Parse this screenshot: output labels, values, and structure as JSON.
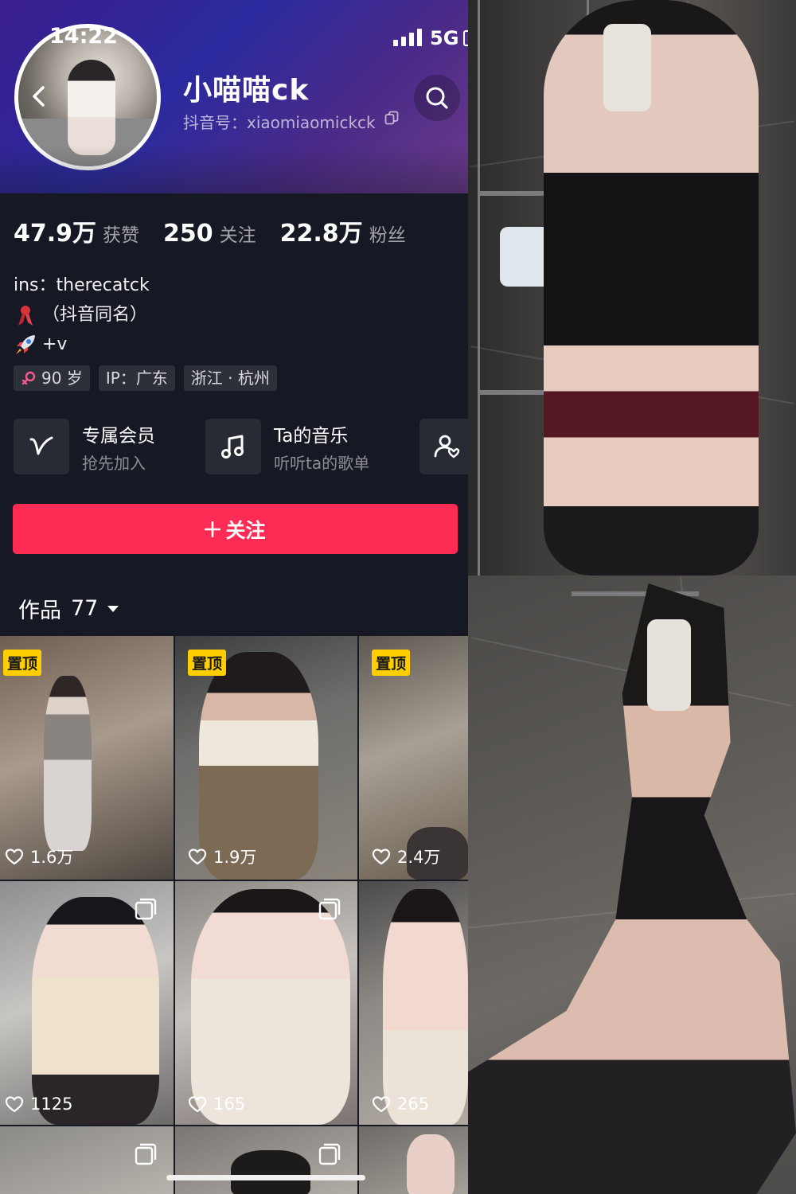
{
  "status_bar": {
    "time": "14:22",
    "network": "5G"
  },
  "profile": {
    "nickname": "小喵喵ck",
    "douyin_id": "抖音号：xiaomiaomickck",
    "stats": [
      {
        "value": "47.9万",
        "label": "获赞"
      },
      {
        "value": "250",
        "label": "关注"
      },
      {
        "value": "22.8万",
        "label": "粉丝"
      }
    ],
    "bio": [
      {
        "text": "ins：therecatck",
        "icon": ""
      },
      {
        "text": "（抖音同名）",
        "icon": "ribbon-emoji-icon"
      },
      {
        "text": "+v",
        "icon": "rocket-emoji-icon"
      }
    ],
    "tags": [
      {
        "text": "90 岁",
        "icon": "female-icon"
      },
      {
        "text": "IP：广东",
        "icon": ""
      },
      {
        "text": "浙江 · 杭州",
        "icon": ""
      }
    ]
  },
  "features": [
    {
      "title": "专属会员",
      "subtitle": "抢先加入",
      "icon": "membership-v-icon"
    },
    {
      "title": "Ta的音乐",
      "subtitle": "听听ta的歌单",
      "icon": "music-note-icon"
    },
    {
      "title": "",
      "subtitle": "",
      "icon": "user-heart-icon"
    }
  ],
  "follow_button": "关注",
  "works": {
    "label": "作品",
    "count": "77"
  },
  "videos": [
    {
      "pinned": "置顶",
      "likes": "1.6万",
      "multi": false
    },
    {
      "pinned": "置顶",
      "likes": "1.9万",
      "multi": false
    },
    {
      "pinned": "置顶",
      "likes": "2.4万",
      "multi": false
    },
    {
      "pinned": "",
      "likes": "1125",
      "multi": true
    },
    {
      "pinned": "",
      "likes": "165",
      "multi": true
    },
    {
      "pinned": "",
      "likes": "265",
      "multi": false
    },
    {
      "pinned": "",
      "likes": "",
      "multi": true
    },
    {
      "pinned": "",
      "likes": "",
      "multi": true
    },
    {
      "pinned": "",
      "likes": "",
      "multi": false
    }
  ],
  "colors": {
    "accent": "#fe2c55",
    "pin": "#fece00",
    "background": "#161823"
  }
}
